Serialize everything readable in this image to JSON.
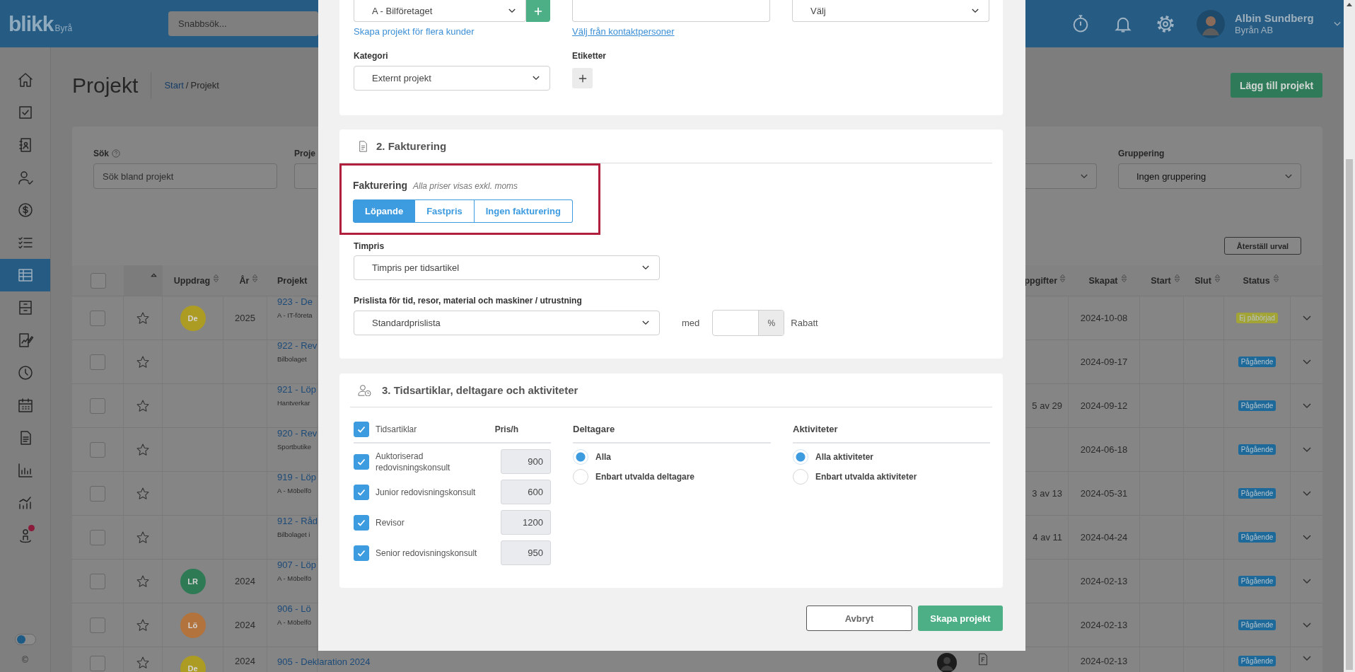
{
  "topbar": {
    "logo": "blikk",
    "logo_suffix": "Byrå",
    "search_placeholder": "Snabbsök...",
    "user": {
      "name": "Albin Sundberg",
      "company": "Byrån AB"
    }
  },
  "sidebar": {
    "items": [
      {
        "selected": false,
        "notification": false
      },
      {
        "selected": false,
        "notification": false
      },
      {
        "selected": false,
        "notification": false
      },
      {
        "selected": false,
        "notification": false
      },
      {
        "selected": false,
        "notification": false
      },
      {
        "selected": false,
        "notification": false
      },
      {
        "selected": true,
        "notification": false
      },
      {
        "selected": false,
        "notification": false
      },
      {
        "selected": false,
        "notification": false
      },
      {
        "selected": false,
        "notification": false
      },
      {
        "selected": false,
        "notification": false
      },
      {
        "selected": false,
        "notification": false
      },
      {
        "selected": false,
        "notification": false
      },
      {
        "selected": false,
        "notification": false
      },
      {
        "selected": false,
        "notification": true
      }
    ],
    "theme_toggle": {
      "on": false
    },
    "footer_mark": "©"
  },
  "page": {
    "title": "Projekt",
    "breadcrumb": [
      {
        "label": "Start",
        "link": true
      },
      {
        "label": "Projekt",
        "link": false
      }
    ],
    "separator": "/",
    "add_button": "Lägg till projekt"
  },
  "filters": {
    "search": {
      "label": "Sök",
      "placeholder": "Sök bland projekt"
    },
    "project": {
      "label": "Proje"
    },
    "grouping": {
      "label": "Gruppering",
      "value": "Ingen gruppering"
    },
    "reset_button": "Återställ urval"
  },
  "table": {
    "select_all_checked": false,
    "star_sorted": true,
    "columns": [
      {
        "label": "Uppdrag",
        "sortable": true
      },
      {
        "label": "År",
        "sortable": true
      },
      {
        "label": "Projekt",
        "sortable": false
      },
      {
        "label": "ppgifter",
        "sortable": true
      },
      {
        "label": "Skapat",
        "sortable": true
      },
      {
        "label": "Start",
        "sortable": true
      },
      {
        "label": "Slut",
        "sortable": true
      },
      {
        "label": "Status",
        "sortable": true
      }
    ],
    "rows": [
      {
        "checked": false,
        "starred": false,
        "assignee": {
          "initials": "De",
          "color": "#ad9c24"
        },
        "year": "2025",
        "title": "923 - De",
        "client": "A - IT-företa",
        "created": "2024-10-08",
        "status": {
          "label": "Ej påbörjad",
          "color": "#a3a436"
        }
      },
      {
        "checked": false,
        "starred": false,
        "title": "922 - Rev",
        "client": "Bilbolaget",
        "created": "2024-09-17",
        "status": {
          "label": "Pågående",
          "color": "#1d6a9a"
        }
      },
      {
        "checked": false,
        "starred": false,
        "title": "921 - Löp",
        "client": "Hantverkar",
        "tasks": "5 av 29",
        "created": "2024-09-12",
        "status": {
          "label": "Pågående",
          "color": "#1d6a9a"
        }
      },
      {
        "checked": false,
        "starred": false,
        "title": "920 - Rev",
        "client": "Sportbutike",
        "created": "2024-06-18",
        "status": {
          "label": "Pågående",
          "color": "#1d6a9a"
        }
      },
      {
        "checked": false,
        "starred": false,
        "title": "919 - Löp",
        "client": "A - Möbelfö",
        "tasks": "3 av 13",
        "created": "2024-05-31",
        "status": {
          "label": "Pågående",
          "color": "#1d6a9a"
        }
      },
      {
        "checked": false,
        "starred": false,
        "title": "912 - Råd",
        "client": "Bilbolaget i",
        "tasks": "4 av 11",
        "created": "2024-04-24",
        "status": {
          "label": "Pågående",
          "color": "#1d6a9a"
        }
      },
      {
        "checked": false,
        "starred": false,
        "assignee": {
          "initials": "LR",
          "color": "#2e7a55"
        },
        "year": "2024",
        "title": "907 - Löp",
        "client": "A - Möbelfö",
        "created": "2024-02-13",
        "status": {
          "label": "Pågående",
          "color": "#1d6a9a"
        }
      },
      {
        "checked": false,
        "starred": false,
        "assignee": {
          "initials": "Lö",
          "color": "#b2733c"
        },
        "year": "2024",
        "title": "906 - Lö",
        "client": "A - Möbelfö",
        "created": "2024-02-13",
        "status": {
          "label": "Pågående",
          "color": "#1d6a9a"
        }
      },
      {
        "checked": false,
        "starred": false,
        "assignee": {
          "initials": "De",
          "color": "#ad9c24"
        },
        "year": "2024",
        "title": "905 - Deklaration 2024",
        "responsible_photo": true,
        "has_document": true,
        "created": "2024-02-13",
        "status": {
          "label": "Pågående",
          "color": "#1d6a9a"
        }
      }
    ]
  },
  "modal": {
    "customer": {
      "value": "A - Bilföretaget"
    },
    "multi_customer_link": "Skapa projekt för flera kunder",
    "contact_link": "Välj från kontaktpersoner",
    "third_select": {
      "value": "Välj"
    },
    "category": {
      "label": "Kategori",
      "value": "Externt projekt"
    },
    "tags": {
      "label": "Etiketter"
    },
    "billing": {
      "title": "2. Fakturering",
      "highlighted": true,
      "label": "Fakturering",
      "note": "Alla priser visas exkl. moms",
      "options": [
        {
          "label": "Löpande",
          "selected": true
        },
        {
          "label": "Fastpris",
          "selected": false
        },
        {
          "label": "Ingen fakturering",
          "selected": false
        }
      ],
      "hourly_rate": {
        "label": "Timpris",
        "value": "Timpris per tidsartikel"
      },
      "price_list": {
        "label": "Prislista för tid, resor, material och maskiner / utrustning",
        "value": "Standardprislista"
      },
      "discount": {
        "prefix": "med",
        "unit": "%",
        "suffix": "Rabatt"
      }
    },
    "resources": {
      "title": "3. Tidsartiklar, deltagare och aktiviteter",
      "articles": {
        "label": "Tidsartiklar",
        "checked": true,
        "price_header": "Pris/h",
        "items": [
          {
            "name": "Auktoriserad redovisningskonsult",
            "checked": true,
            "price": "900"
          },
          {
            "name": "Junior redovisningskonsult",
            "checked": true,
            "price": "600"
          },
          {
            "name": "Revisor",
            "checked": true,
            "price": "1200"
          },
          {
            "name": "Senior redovisningskonsult",
            "checked": true,
            "price": "950"
          }
        ]
      },
      "participants": {
        "title": "Deltagare",
        "options": [
          {
            "label": "Alla",
            "selected": true
          },
          {
            "label": "Enbart utvalda deltagare",
            "selected": false
          }
        ]
      },
      "activities": {
        "title": "Aktiviteter",
        "options": [
          {
            "label": "Alla aktiviteter",
            "selected": true
          },
          {
            "label": "Enbart utvalda aktiviteter",
            "selected": false
          }
        ]
      }
    },
    "buttons": {
      "cancel": "Avbryt",
      "submit": "Skapa projekt"
    }
  }
}
